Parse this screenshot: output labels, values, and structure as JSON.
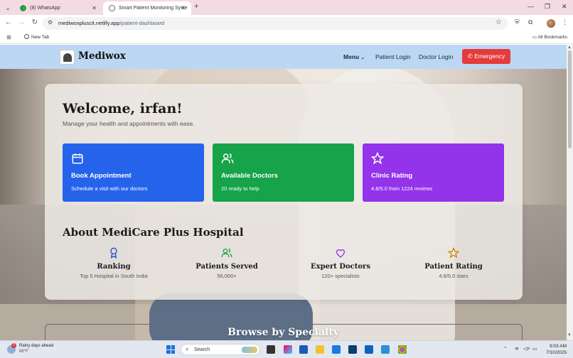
{
  "browser": {
    "tabs": [
      {
        "title": "(8) WhatsApp"
      },
      {
        "title": "Smart Patient Monitoring Syste"
      }
    ],
    "url_host": "mediwoxpluscit.netlify.app",
    "url_path": "/patient-dashboard",
    "bookmarks": {
      "new_tab": "New Tab",
      "all_bookmarks": "All Bookmarks"
    }
  },
  "navbar": {
    "brand": "Mediwox",
    "menu_label": "Menu",
    "patient_login": "Patient Login",
    "doctor_login": "Doctor Login",
    "emergency_label": "Emergency"
  },
  "dashboard": {
    "welcome": "Welcome, irfan!",
    "subtitle": "Manage your health and appointments with ease.",
    "tiles": [
      {
        "title": "Book Appointment",
        "subtitle": "Schedule a visit with our doctors",
        "icon": "calendar-icon",
        "color": "#2563eb"
      },
      {
        "title": "Available Doctors",
        "subtitle": "20 ready to help",
        "icon": "users-icon",
        "color": "#16a34a"
      },
      {
        "title": "Clinic Rating",
        "subtitle": "4.8/5.0 from 1224 reviews",
        "icon": "star-icon",
        "color": "#9333ea"
      }
    ],
    "about_title": "About MediCare Plus Hospital",
    "stats": [
      {
        "label": "Ranking",
        "value": "Top 5 Hospital in South India",
        "icon": "award-icon",
        "color": "#1d4ed8"
      },
      {
        "label": "Patients Served",
        "value": "56,000+",
        "icon": "users-icon",
        "color": "#16a34a"
      },
      {
        "label": "Expert Doctors",
        "value": "120+ specialists",
        "icon": "heart-icon",
        "color": "#9333ea"
      },
      {
        "label": "Patient Rating",
        "value": "4.8/5.0 stars",
        "icon": "star-icon",
        "color": "#ca8a04"
      }
    ],
    "browse_title": "Browse by Specialty"
  },
  "taskbar": {
    "weather_line1": "Rainy days ahead",
    "weather_line2": "88°F",
    "notification_count": "2",
    "search_placeholder": "Search",
    "time": "9:03 AM",
    "date": "7/10/2025"
  }
}
